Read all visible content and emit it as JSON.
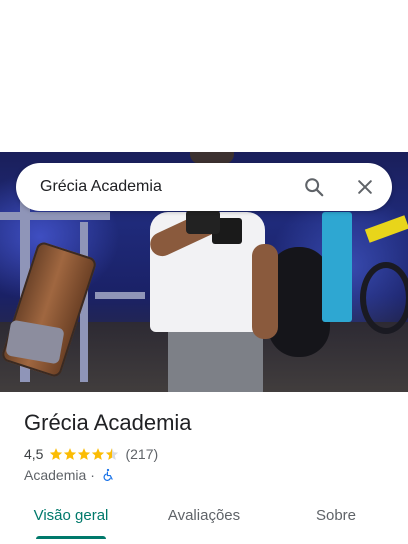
{
  "search": {
    "query": "Grécia Academia",
    "search_icon": "search-icon",
    "close_icon": "close-icon"
  },
  "place": {
    "name": "Grécia Academia",
    "rating": "4,5",
    "rating_stars_value": 4.5,
    "review_count": "(217)",
    "category": "Academia",
    "separator": "·",
    "accessibility_icon": "wheelchair-accessible-icon"
  },
  "tabs": [
    {
      "label": "Visão geral",
      "active": true
    },
    {
      "label": "Avaliações",
      "active": false
    },
    {
      "label": "Sobre",
      "active": false
    }
  ],
  "colors": {
    "accent": "#00796b",
    "star": "#fbbc04",
    "accessibility": "#1a73e8"
  }
}
